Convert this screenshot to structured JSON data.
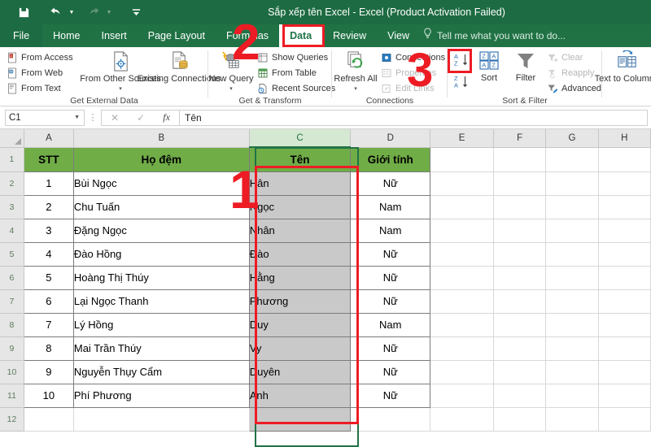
{
  "window": {
    "title": "Sắp xếp tên Excel - Excel (Product Activation Failed)",
    "quick_access": [
      {
        "name": "save-icon",
        "label": "Save"
      },
      {
        "name": "undo-icon",
        "label": "Undo"
      },
      {
        "name": "redo-icon",
        "label": "Redo"
      },
      {
        "name": "customize-quick-access-icon",
        "label": "Customize Quick Access Toolbar"
      }
    ]
  },
  "ribbon": {
    "tabs": [
      {
        "label": "File",
        "active": false
      },
      {
        "label": "Home",
        "active": false
      },
      {
        "label": "Insert",
        "active": false
      },
      {
        "label": "Page Layout",
        "active": false
      },
      {
        "label": "Formulas",
        "active": false
      },
      {
        "label": "Data",
        "active": true
      },
      {
        "label": "Review",
        "active": false
      },
      {
        "label": "View",
        "active": false
      }
    ],
    "tell_me": "Tell me what you want to do...",
    "groups": {
      "get_external_data": {
        "label": "Get External Data",
        "items": [
          {
            "label": "From Access",
            "icon": "from-access-icon"
          },
          {
            "label": "From Web",
            "icon": "from-web-icon"
          },
          {
            "label": "From Text",
            "icon": "from-text-icon"
          },
          {
            "label": "From Other Sources",
            "icon": "from-other-sources-icon",
            "caret": "▾"
          },
          {
            "label": "Existing Connections",
            "icon": "existing-connections-icon"
          }
        ]
      },
      "get_transform": {
        "label": "Get & Transform",
        "items": [
          {
            "label": "New Query",
            "icon": "new-query-icon",
            "caret": "▾"
          },
          {
            "label": "Show Queries",
            "icon": "show-queries-icon"
          },
          {
            "label": "From Table",
            "icon": "from-table-icon"
          },
          {
            "label": "Recent Sources",
            "icon": "recent-sources-icon"
          }
        ]
      },
      "connections": {
        "label": "Connections",
        "items": [
          {
            "label": "Refresh All",
            "icon": "refresh-all-icon",
            "caret": "▾"
          },
          {
            "label": "Connections",
            "icon": "connections-icon",
            "disabled": false
          },
          {
            "label": "Properties",
            "icon": "properties-icon",
            "disabled": true
          },
          {
            "label": "Edit Links",
            "icon": "edit-links-icon",
            "disabled": true
          }
        ]
      },
      "sort_filter": {
        "label": "Sort & Filter",
        "items": [
          {
            "label": "Sort A to Z",
            "icon": "sort-az-icon",
            "highlighted": true
          },
          {
            "label": "Sort Z to A",
            "icon": "sort-za-icon"
          },
          {
            "label": "Sort",
            "icon": "sort-icon"
          },
          {
            "label": "Filter",
            "icon": "filter-icon"
          },
          {
            "label": "Clear",
            "icon": "clear-filter-icon",
            "disabled": true
          },
          {
            "label": "Reapply",
            "icon": "reapply-icon",
            "disabled": true
          },
          {
            "label": "Advanced",
            "icon": "advanced-filter-icon",
            "disabled": false
          }
        ]
      },
      "data_tools": {
        "label": "",
        "items": [
          {
            "label": "Text to Columns",
            "icon": "text-to-columns-icon"
          }
        ]
      }
    }
  },
  "formula_bar": {
    "name_box": "C1",
    "formula": "Tên",
    "cancel_icon": "cancel-icon",
    "enter_icon": "enter-icon",
    "fx_icon": "insert-function-icon"
  },
  "sheet": {
    "column_headers": [
      "A",
      "B",
      "C",
      "D",
      "E",
      "F",
      "G",
      "H"
    ],
    "selected_column": "C",
    "row_headers": [
      "1",
      "2",
      "3",
      "4",
      "5",
      "6",
      "7",
      "8",
      "9",
      "10",
      "11",
      "12"
    ],
    "table_headers": [
      "STT",
      "Họ đệm",
      "Tên",
      "Giới tính"
    ],
    "rows": [
      {
        "stt": "1",
        "ho_dem": "Bùi Ngọc",
        "ten": "Hân",
        "gioi_tinh": "Nữ"
      },
      {
        "stt": "2",
        "ho_dem": "Chu Tuấn",
        "ten": "Ngọc",
        "gioi_tinh": "Nam"
      },
      {
        "stt": "3",
        "ho_dem": "Đặng Ngọc",
        "ten": "Nhân",
        "gioi_tinh": "Nam"
      },
      {
        "stt": "4",
        "ho_dem": "Đào Hồng",
        "ten": "Đào",
        "gioi_tinh": "Nữ"
      },
      {
        "stt": "5",
        "ho_dem": "Hoàng Thị Thúy",
        "ten": "Hằng",
        "gioi_tinh": "Nữ"
      },
      {
        "stt": "6",
        "ho_dem": "Lại Ngọc Thanh",
        "ten": "Phương",
        "gioi_tinh": "Nữ"
      },
      {
        "stt": "7",
        "ho_dem": "Lý Hồng",
        "ten": "Duy",
        "gioi_tinh": "Nam"
      },
      {
        "stt": "8",
        "ho_dem": "Mai Trần Thúy",
        "ten": "Vy",
        "gioi_tinh": "Nữ"
      },
      {
        "stt": "9",
        "ho_dem": "Nguyễn Thụy Cẩm",
        "ten": "Duyên",
        "gioi_tinh": "Nữ"
      },
      {
        "stt": "10",
        "ho_dem": "Phí Phương",
        "ten": "Anh",
        "gioi_tinh": "Nữ"
      }
    ]
  },
  "annotations": {
    "color": "#ED1C24",
    "markers": [
      {
        "label": "1",
        "target": "column-c-selection"
      },
      {
        "label": "2",
        "target": "data-tab"
      },
      {
        "label": "3",
        "target": "sort-az-button"
      }
    ]
  },
  "colors": {
    "title_bar": "#1D6B42",
    "ribbon_tabs": "#207245",
    "table_header_fill": "#70AD47",
    "selection_shade": "#C9C9C9",
    "annotation_red": "#ED1C24",
    "excel_green": "#217346"
  }
}
